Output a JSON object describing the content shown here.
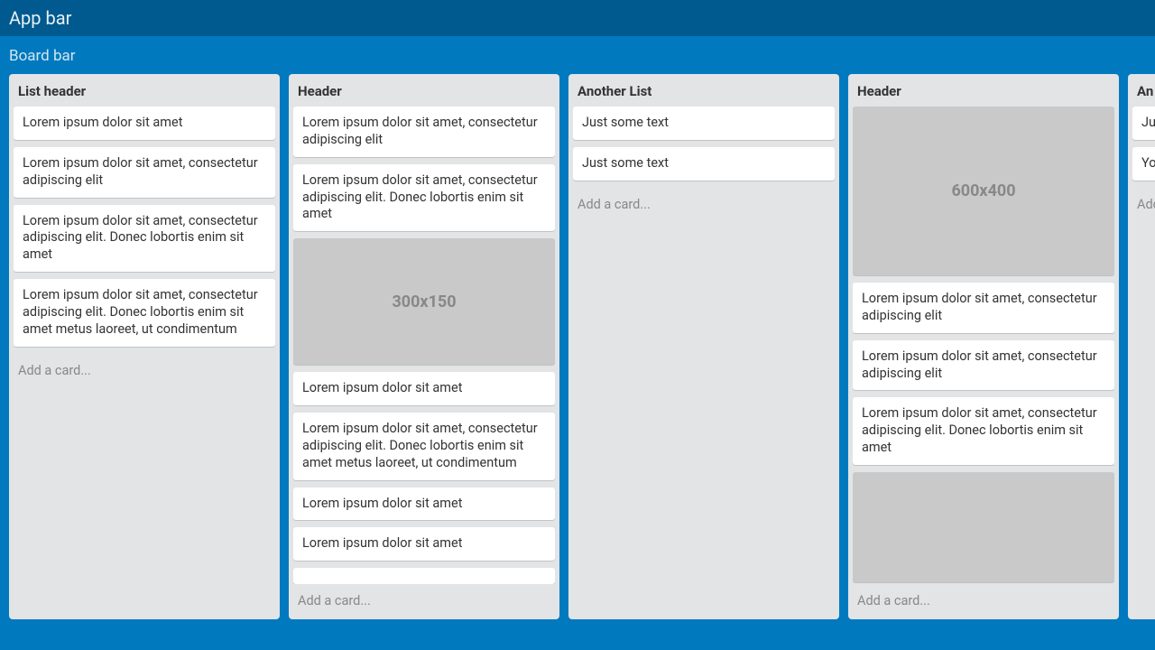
{
  "appBar": {
    "title": "App bar"
  },
  "boardBar": {
    "title": "Board bar"
  },
  "addCardLabel": "Add a card...",
  "lists": [
    {
      "header": "List header",
      "cards": [
        {
          "text": "Lorem ipsum dolor sit amet"
        },
        {
          "text": "Lorem ipsum dolor sit amet, consectetur adipiscing elit"
        },
        {
          "text": "Lorem ipsum dolor sit amet, consectetur adipiscing elit. Donec lobortis enim sit amet"
        },
        {
          "text": "Lorem ipsum dolor sit amet, consectetur adipiscing elit. Donec lobortis enim sit amet metus laoreet, ut condimentum"
        }
      ]
    },
    {
      "header": "Header",
      "cards": [
        {
          "text": "Lorem ipsum dolor sit amet, consectetur adipiscing elit"
        },
        {
          "text": "Lorem ipsum dolor sit amet, consectetur adipiscing elit. Donec lobortis enim sit amet"
        },
        {
          "image": true,
          "label": "300x150",
          "cls": "h150"
        },
        {
          "text": "Lorem ipsum dolor sit amet"
        },
        {
          "text": "Lorem ipsum dolor sit amet, consectetur adipiscing elit. Donec lobortis enim sit amet metus laoreet, ut condimentum"
        },
        {
          "text": "Lorem ipsum dolor sit amet"
        },
        {
          "text": "Lorem ipsum dolor sit amet"
        },
        {
          "text": ""
        }
      ]
    },
    {
      "header": "Another List",
      "cards": [
        {
          "text": "Just some text"
        },
        {
          "text": "Just some text"
        }
      ]
    },
    {
      "header": "Header",
      "cards": [
        {
          "image": true,
          "label": "600x400",
          "cls": "h400"
        },
        {
          "text": "Lorem ipsum dolor sit amet, consectetur adipiscing elit"
        },
        {
          "text": "Lorem ipsum dolor sit amet, consectetur adipiscing elit"
        },
        {
          "text": "Lorem ipsum dolor sit amet, consectetur adipiscing elit. Donec lobortis enim sit amet"
        },
        {
          "image": true,
          "label": "",
          "cls": "hpartial"
        }
      ]
    },
    {
      "header": "An",
      "cards": [
        {
          "text": "Ju"
        },
        {
          "text": "Yo"
        }
      ]
    }
  ]
}
